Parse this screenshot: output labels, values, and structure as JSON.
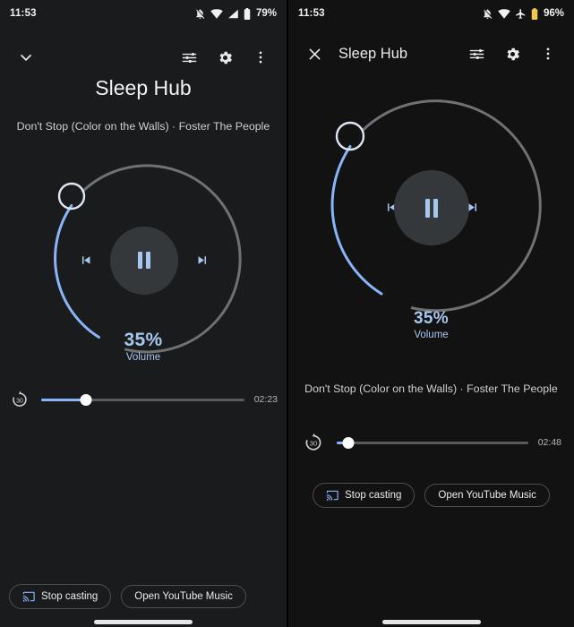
{
  "left": {
    "status": {
      "time": "11:53",
      "battery_pct": "79%",
      "icons": [
        "notifications-off-icon",
        "wifi-icon",
        "signal-icon",
        "battery-icon"
      ]
    },
    "appbar": {
      "collapse_icon": "chevron-down-icon",
      "tune_icon": "tune-icon",
      "settings_icon": "gear-icon",
      "overflow_icon": "more-vert-icon"
    },
    "title": "Sleep Hub",
    "subtitle": "Don't Stop (Color on the Walls) · Foster The People",
    "dial": {
      "percent": "35%",
      "label": "Volume",
      "value": 35,
      "knob_icon": "volume-knob",
      "arc_active_color": "#8ab4f8",
      "arc_track_color": "#777777"
    },
    "transport": {
      "previous_icon": "skip-previous-icon",
      "play_pause_icon": "pause-icon",
      "next_icon": "skip-next-icon"
    },
    "seek": {
      "replay_icon": "replay-30-icon",
      "progress": 22,
      "time": "02:23"
    },
    "buttons": {
      "stop_casting": "Stop casting",
      "stop_casting_icon": "cast-connected-icon",
      "open_app": "Open YouTube Music"
    }
  },
  "right": {
    "status": {
      "time": "11:53",
      "battery_pct": "96%",
      "icons": [
        "notifications-off-icon",
        "wifi-icon",
        "airplane-icon",
        "battery-saver-icon"
      ]
    },
    "appbar": {
      "close_icon": "close-icon",
      "title": "Sleep Hub",
      "tune_icon": "tune-icon",
      "settings_icon": "gear-icon",
      "overflow_icon": "more-vert-icon"
    },
    "dial": {
      "percent": "35%",
      "label": "Volume",
      "value": 35,
      "knob_icon": "volume-knob",
      "arc_active_color": "#8ab4f8",
      "arc_track_color": "#777777"
    },
    "transport": {
      "previous_icon": "skip-previous-icon",
      "play_pause_icon": "pause-icon",
      "next_icon": "skip-next-icon"
    },
    "subtitle": "Don't Stop (Color on the Walls) · Foster The People",
    "seek": {
      "replay_icon": "replay-30-icon",
      "progress": 6,
      "time": "02:48"
    },
    "buttons": {
      "stop_casting": "Stop casting",
      "stop_casting_icon": "cast-connected-icon",
      "open_app": "Open YouTube Music"
    }
  },
  "colors": {
    "accent_blue": "#8ab4f8",
    "accent_light_blue": "#a8c7f0",
    "panel_left_bg": "#191b1c",
    "panel_right_bg": "#121212",
    "battery_saver": "#f2c94c"
  }
}
